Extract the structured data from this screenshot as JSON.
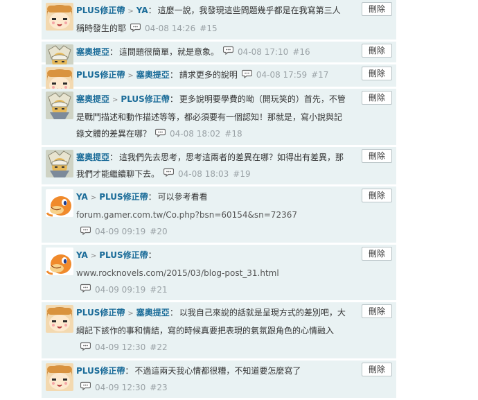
{
  "comments": [
    {
      "avatar": "girl",
      "user1": "PLUS修正帶",
      "user2": "YA",
      "text": "這麼一說，我發現這些問題幾乎都是在我寫第三人稱時發生的耶",
      "date": "04-08 14:26",
      "floor": "#15"
    },
    {
      "avatar": "knight",
      "user1": "塞奧提亞",
      "user2": "",
      "text": "這問題很簡單，就是意象。",
      "date": "04-08 17:10",
      "floor": "#16"
    },
    {
      "avatar": "girl",
      "user1": "PLUS修正帶",
      "user2": "塞奧提亞",
      "text": "請求更多的說明",
      "date": "04-08 17:59",
      "floor": "#17"
    },
    {
      "avatar": "knight",
      "user1": "塞奧提亞",
      "user2": "PLUS修正帶",
      "text": "更多說明要學費的呦（開玩笑的）首先，不管是戰鬥描述和動作描述等等，都必須要有一個認知！那就是，寫小說與記錄文體的差異在哪？",
      "date": "04-08 18:02",
      "floor": "#18"
    },
    {
      "avatar": "knight",
      "user1": "塞奧提亞",
      "user2": "",
      "text": "這我們先去思考，思考這兩者的差異在哪？如得出有差異，那我們才能繼續聊下去。",
      "date": "04-08 18:03",
      "floor": "#19"
    },
    {
      "avatar": "dragon",
      "user1": "YA",
      "user2": "PLUS修正帶",
      "text": "可以參考看看",
      "link": "forum.gamer.com.tw/Co.php?bsn=60154&sn=72367",
      "date": "04-09 09:19",
      "floor": "#20"
    },
    {
      "avatar": "dragon",
      "user1": "YA",
      "user2": "PLUS修正帶",
      "text": "",
      "link": "www.rocknovels.com/2015/03/blog-post_31.html",
      "date": "04-09 09:19",
      "floor": "#21"
    },
    {
      "avatar": "girl",
      "user1": "PLUS修正帶",
      "user2": "塞奧提亞",
      "text": "以我自己來說的話就是呈現方式的差別吧，大綱記下該作的事和情結，寫的時候真要把表現的氣氛跟角色的心情融入",
      "date": "04-09 12:30",
      "floor": "#22"
    },
    {
      "avatar": "girl",
      "user1": "PLUS修正帶",
      "user2": "",
      "text": "不過這兩天我心情都很糟，不知道要怎麼寫了",
      "date": "04-09 12:30",
      "floor": "#23"
    }
  ],
  "delete_label": "刪除",
  "arrow_glyph": ">",
  "colon_glyph": "：",
  "colors": {
    "bg": "#e9f2f3",
    "user": "#1b6c99",
    "meta": "#9aa2a6"
  }
}
